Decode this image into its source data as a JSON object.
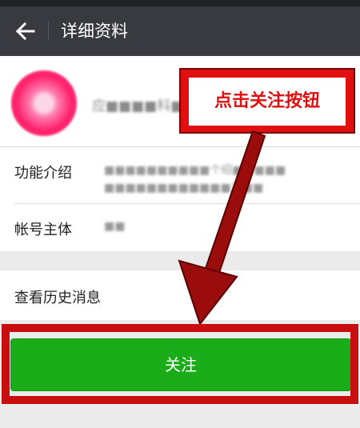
{
  "header": {
    "title": "详细资料"
  },
  "profile": {
    "name_text": "应■■■■科■"
  },
  "rows": {
    "intro_label": "功能介绍",
    "intro_value_line1": "■■■■■■■■■■个绍■新■■■",
    "intro_value_line2": "■■■■■■■■■■■■息■■",
    "owner_label": "帐号主体",
    "owner_value": "■■",
    "history_label": "查看历史消息"
  },
  "follow_button": {
    "label": "关注"
  },
  "annotation": {
    "text": "点击关注按钮"
  },
  "colors": {
    "header_bg": "#393a3f",
    "follow_green": "#1aad19",
    "annotation_red": "#e01010"
  },
  "icons": {
    "back": "arrow-left-icon"
  }
}
